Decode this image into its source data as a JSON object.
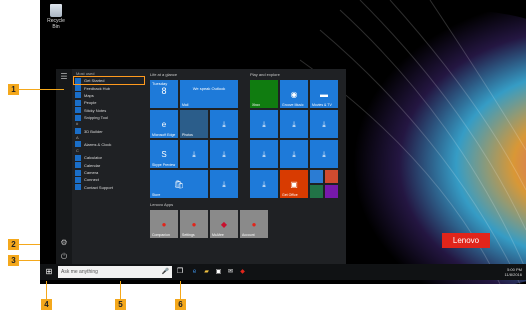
{
  "desktop": {
    "recycle_bin_label": "Recycle Bin"
  },
  "rail": {
    "hamburger": "☰",
    "settings": "⚙",
    "power": "⏻"
  },
  "applist": {
    "most_used_header": "Most used",
    "items": [
      "Get Started",
      "Feedback Hub",
      "Maps",
      "People",
      "Sticky Notes",
      "Snipping Tool"
    ],
    "number_header": "#",
    "number_items": [
      "3D Builder"
    ],
    "a_header": "A",
    "a_items": [
      "Alarms & Clock"
    ],
    "c_header": "C",
    "c_items": [
      "Calculator",
      "Calendar",
      "Camera",
      "Connect",
      "Contact Support"
    ]
  },
  "tiles": {
    "life_header": "Life at a glance",
    "play_header": "Play and explore",
    "lenovo_header": "Lenovo Apps",
    "calendar_day": "Tuesday",
    "calendar_date": "8",
    "mail_text": "We speak Outlook",
    "mail_label": "Mail",
    "edge_label": "Microsoft Edge",
    "photos_label": "Photos",
    "skype_label": "Skype Preview",
    "store_label": "Store",
    "xbox_label": "Xbox",
    "groove_label": "Groove Music",
    "movies_label": "Movies & TV",
    "office_label": "Get Office",
    "onenote_label": "OneNote",
    "companion_label": "Companion",
    "settings_label": "Settings",
    "mcafee_label": "McAfee",
    "account_label": "Account",
    "placeholder_label": "It's all good"
  },
  "taskbar": {
    "search_placeholder": "Ask me anything",
    "mic_icon": "🎤",
    "clock_time": "5:00 PM",
    "clock_date": "11/8/2016"
  },
  "branding": {
    "logo_text": "Lenovo"
  },
  "callouts": [
    "1",
    "2",
    "3",
    "4",
    "5",
    "6"
  ],
  "colors": {
    "accent": "#1e7ad9",
    "callout": "#f4a81c",
    "lenovo": "#e1251b",
    "office": "#d83b01",
    "onenote": "#7719aa",
    "xbox": "#107c10"
  }
}
